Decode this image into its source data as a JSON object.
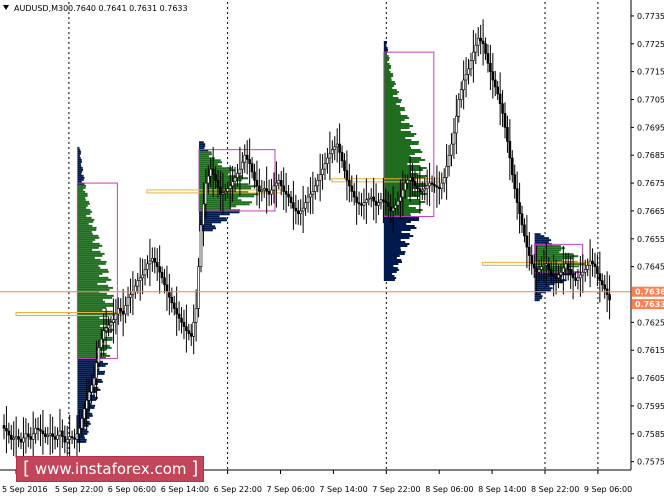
{
  "title": {
    "symbol": "AUDUSD,M30",
    "quote": "0.7640 0.7641 0.7631 0.7633"
  },
  "watermark": {
    "open_bracket": "[",
    "text": "www.instaforex.com",
    "close_bracket": "]"
  },
  "colors": {
    "background": "#ffffff",
    "candles": "#000000",
    "grid_vertical": "#000000",
    "profile_green": "#1f6e1f",
    "profile_dark": "#001a4d",
    "value_area_box": "#c040c0",
    "poc_line": "#f0b030",
    "current_price_line": "#ff7f50",
    "price_tag": "#ff7f50"
  },
  "chart_data": {
    "type": "candlestick",
    "symbol": "AUDUSD",
    "timeframe": "M30",
    "ylim": [
      0.7572,
      0.774
    ],
    "y_ticks": [
      "0.7735",
      "0.7725",
      "0.7715",
      "0.7705",
      "0.7695",
      "0.7685",
      "0.7675",
      "0.7665",
      "0.7655",
      "0.7645",
      "0.7625",
      "0.7615",
      "0.7605",
      "0.7595",
      "0.7585",
      "0.7575"
    ],
    "x_ticks": [
      "5 Sep 2016",
      "5 Sep 22:00",
      "6 Sep 06:00",
      "6 Sep 14:00",
      "6 Sep 22:00",
      "7 Sep 06:00",
      "7 Sep 14:00",
      "7 Sep 22:00",
      "8 Sep 06:00",
      "8 Sep 14:00",
      "8 Sep 22:00",
      "9 Sep 06:00"
    ],
    "session_separators": [
      "5 Sep 22:00",
      "6 Sep 22:00",
      "7 Sep 22:00",
      "8 Sep 22:00",
      "9 Sep 06:00"
    ],
    "price_levels": [
      {
        "label": "0.7636",
        "value": 0.7636,
        "style": "current"
      },
      {
        "label": "0.7633",
        "value": 0.7633,
        "style": "bid"
      }
    ],
    "close_path": [
      [
        0,
        0.7588
      ],
      [
        2,
        0.7586
      ],
      [
        4,
        0.7583
      ],
      [
        6,
        0.7584
      ],
      [
        8,
        0.7582
      ],
      [
        10,
        0.7585
      ],
      [
        12,
        0.7583
      ],
      [
        14,
        0.7587
      ],
      [
        16,
        0.7586
      ],
      [
        18,
        0.7584
      ],
      [
        20,
        0.7585
      ],
      [
        22,
        0.7583
      ],
      [
        24,
        0.7586
      ],
      [
        26,
        0.7582
      ],
      [
        28,
        0.7584
      ],
      [
        30,
        0.7583
      ],
      [
        32,
        0.7587
      ],
      [
        34,
        0.7594
      ],
      [
        36,
        0.76
      ],
      [
        38,
        0.7605
      ],
      [
        40,
        0.7616
      ],
      [
        42,
        0.7622
      ],
      [
        44,
        0.7624
      ],
      [
        46,
        0.7626
      ],
      [
        48,
        0.763
      ],
      [
        50,
        0.7628
      ],
      [
        52,
        0.7634
      ],
      [
        54,
        0.7636
      ],
      [
        56,
        0.764
      ],
      [
        58,
        0.7642
      ],
      [
        60,
        0.7646
      ],
      [
        62,
        0.7648
      ],
      [
        64,
        0.7645
      ],
      [
        66,
        0.7641
      ],
      [
        68,
        0.7636
      ],
      [
        70,
        0.7632
      ],
      [
        72,
        0.7628
      ],
      [
        74,
        0.7625
      ],
      [
        76,
        0.7622
      ],
      [
        78,
        0.762
      ],
      [
        80,
        0.763
      ],
      [
        82,
        0.766
      ],
      [
        84,
        0.7675
      ],
      [
        86,
        0.768
      ],
      [
        88,
        0.7676
      ],
      [
        90,
        0.7671
      ],
      [
        92,
        0.7672
      ],
      [
        94,
        0.7674
      ],
      [
        96,
        0.7677
      ],
      [
        98,
        0.768
      ],
      [
        100,
        0.7685
      ],
      [
        102,
        0.7682
      ],
      [
        104,
        0.7676
      ],
      [
        106,
        0.7672
      ],
      [
        108,
        0.7673
      ],
      [
        110,
        0.7671
      ],
      [
        112,
        0.7674
      ],
      [
        114,
        0.7676
      ],
      [
        116,
        0.7672
      ],
      [
        118,
        0.767
      ],
      [
        120,
        0.7666
      ],
      [
        122,
        0.7664
      ],
      [
        124,
        0.7666
      ],
      [
        126,
        0.767
      ],
      [
        128,
        0.7672
      ],
      [
        130,
        0.7676
      ],
      [
        132,
        0.768
      ],
      [
        134,
        0.7684
      ],
      [
        136,
        0.7687
      ],
      [
        138,
        0.7689
      ],
      [
        140,
        0.7683
      ],
      [
        142,
        0.7676
      ],
      [
        144,
        0.7672
      ],
      [
        146,
        0.7668
      ],
      [
        148,
        0.7667
      ],
      [
        150,
        0.7669
      ],
      [
        152,
        0.767
      ],
      [
        154,
        0.7667
      ],
      [
        156,
        0.7669
      ],
      [
        158,
        0.7668
      ],
      [
        160,
        0.7665
      ],
      [
        162,
        0.7667
      ],
      [
        164,
        0.767
      ],
      [
        166,
        0.7675
      ],
      [
        168,
        0.7677
      ],
      [
        170,
        0.7674
      ],
      [
        172,
        0.7672
      ],
      [
        174,
        0.7673
      ],
      [
        176,
        0.7675
      ],
      [
        178,
        0.7674
      ],
      [
        180,
        0.7673
      ],
      [
        182,
        0.7677
      ],
      [
        184,
        0.7685
      ],
      [
        186,
        0.7693
      ],
      [
        188,
        0.7705
      ],
      [
        190,
        0.7712
      ],
      [
        192,
        0.7716
      ],
      [
        194,
        0.7722
      ],
      [
        196,
        0.7727
      ],
      [
        198,
        0.7725
      ],
      [
        200,
        0.7718
      ],
      [
        202,
        0.7712
      ],
      [
        204,
        0.7707
      ],
      [
        206,
        0.77
      ],
      [
        208,
        0.769
      ],
      [
        210,
        0.7678
      ],
      [
        212,
        0.7668
      ],
      [
        214,
        0.766
      ],
      [
        216,
        0.7652
      ],
      [
        218,
        0.7646
      ],
      [
        220,
        0.7643
      ],
      [
        222,
        0.7645
      ],
      [
        224,
        0.7646
      ],
      [
        226,
        0.7642
      ],
      [
        228,
        0.7641
      ],
      [
        230,
        0.7643
      ],
      [
        232,
        0.7646
      ],
      [
        234,
        0.7642
      ],
      [
        236,
        0.764
      ],
      [
        238,
        0.7642
      ],
      [
        240,
        0.7644
      ],
      [
        242,
        0.7647
      ],
      [
        244,
        0.7645
      ],
      [
        246,
        0.764
      ],
      [
        248,
        0.7637
      ],
      [
        250,
        0.7633
      ]
    ],
    "volume_profiles": [
      {
        "session": "5 Sep 22:00",
        "poc": 0.7628,
        "va_high": 0.7675,
        "va_low": 0.7612,
        "hist_top": 0.7688,
        "hist_bottom": 0.7582
      },
      {
        "session": "6 Sep 22:00",
        "poc": 0.7672,
        "va_high": 0.7687,
        "va_low": 0.7665,
        "hist_top": 0.769,
        "hist_bottom": 0.7658
      },
      {
        "session": "7 Sep 22:00",
        "poc": 0.7676,
        "va_high": 0.7722,
        "va_low": 0.7663,
        "hist_top": 0.7726,
        "hist_bottom": 0.764
      },
      {
        "session": "8 Sep 22:00",
        "poc": 0.7646,
        "va_high": 0.7653,
        "va_low": 0.7643,
        "hist_top": 0.7657,
        "hist_bottom": 0.7633
      }
    ]
  }
}
